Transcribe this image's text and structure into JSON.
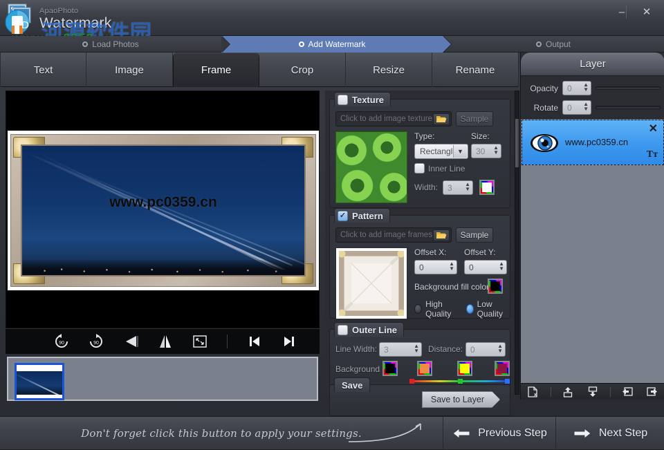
{
  "window": {
    "brand_small": "ApaoPhoto",
    "brand_big": "Watermark",
    "minimize": "–",
    "close": "✕",
    "watermark_cn": "河源软件园",
    "watermark_url": "www.pc0359.cn"
  },
  "steps": [
    {
      "label": "Load Photos",
      "active": false
    },
    {
      "label": "Add Watermark",
      "active": true
    },
    {
      "label": "Output",
      "active": false
    }
  ],
  "tabs": [
    {
      "label": "Text",
      "active": false
    },
    {
      "label": "Image",
      "active": false
    },
    {
      "label": "Frame",
      "active": true
    },
    {
      "label": "Crop",
      "active": false
    },
    {
      "label": "Resize",
      "active": false
    },
    {
      "label": "Rename",
      "active": false
    }
  ],
  "preview": {
    "photo_watermark_text": "www.pc0359.cn",
    "tools": [
      {
        "name": "rotate-left-90",
        "label": "90"
      },
      {
        "name": "rotate-right-90",
        "label": "90"
      },
      {
        "name": "flip-horizontal",
        "label": ""
      },
      {
        "name": "flip-vertical",
        "label": ""
      },
      {
        "name": "fit-to-screen",
        "label": ""
      },
      {
        "name": "previous-photo",
        "label": ""
      },
      {
        "name": "next-photo",
        "label": ""
      }
    ]
  },
  "texture": {
    "group_title": "Texture",
    "enabled": false,
    "file_placeholder": "Click to add image texture...",
    "sample_label": "Sample",
    "type_label": "Type:",
    "type_value": "Rectangle",
    "size_label": "Size:",
    "size_value": "30",
    "inner_line_label": "Inner Line",
    "inner_line_checked": false,
    "width_label": "Width:",
    "width_value": "3",
    "inner_line_color": "#ffffff"
  },
  "pattern": {
    "group_title": "Pattern",
    "enabled": true,
    "file_placeholder": "Click to add image frames...",
    "sample_label": "Sample",
    "offset_x_label": "Offset X:",
    "offset_x_value": "0",
    "offset_y_label": "Offset Y:",
    "offset_y_value": "0",
    "bg_fill_label": "Background fill color:",
    "bg_fill_color": "#000000",
    "quality_high_label": "High Quality",
    "quality_low_label": "Low Quality",
    "quality_selected": "Low Quality"
  },
  "outer_line": {
    "group_title": "Outer Line",
    "enabled": false,
    "line_width_label": "Line Width:",
    "line_width_value": "3",
    "distance_label": "Distance:",
    "distance_value": "0",
    "background_label": "Background",
    "swatches": [
      "#000000",
      "#f08b44",
      "#ffff00",
      "#8e1446"
    ]
  },
  "save": {
    "group_title": "Save",
    "button_label": "Save to Layer"
  },
  "layer_panel": {
    "title": "Layer",
    "opacity_label": "Opacity",
    "opacity_value": "0",
    "rotate_label": "Rotate",
    "rotate_value": "0",
    "items": [
      {
        "name": "www.pc0359.cn",
        "type_icon": "Tᴛ",
        "close_icon": "✕",
        "selected": true
      }
    ],
    "tools": [
      {
        "name": "delete-layer-icon"
      },
      {
        "name": "move-layer-up-icon"
      },
      {
        "name": "move-layer-down-icon"
      },
      {
        "name": "import-layer-icon"
      },
      {
        "name": "export-layer-icon"
      }
    ]
  },
  "bottom": {
    "hint": "Don't forget click this button to apply your settings.",
    "previous_label": "Previous Step",
    "next_label": "Next Step"
  }
}
